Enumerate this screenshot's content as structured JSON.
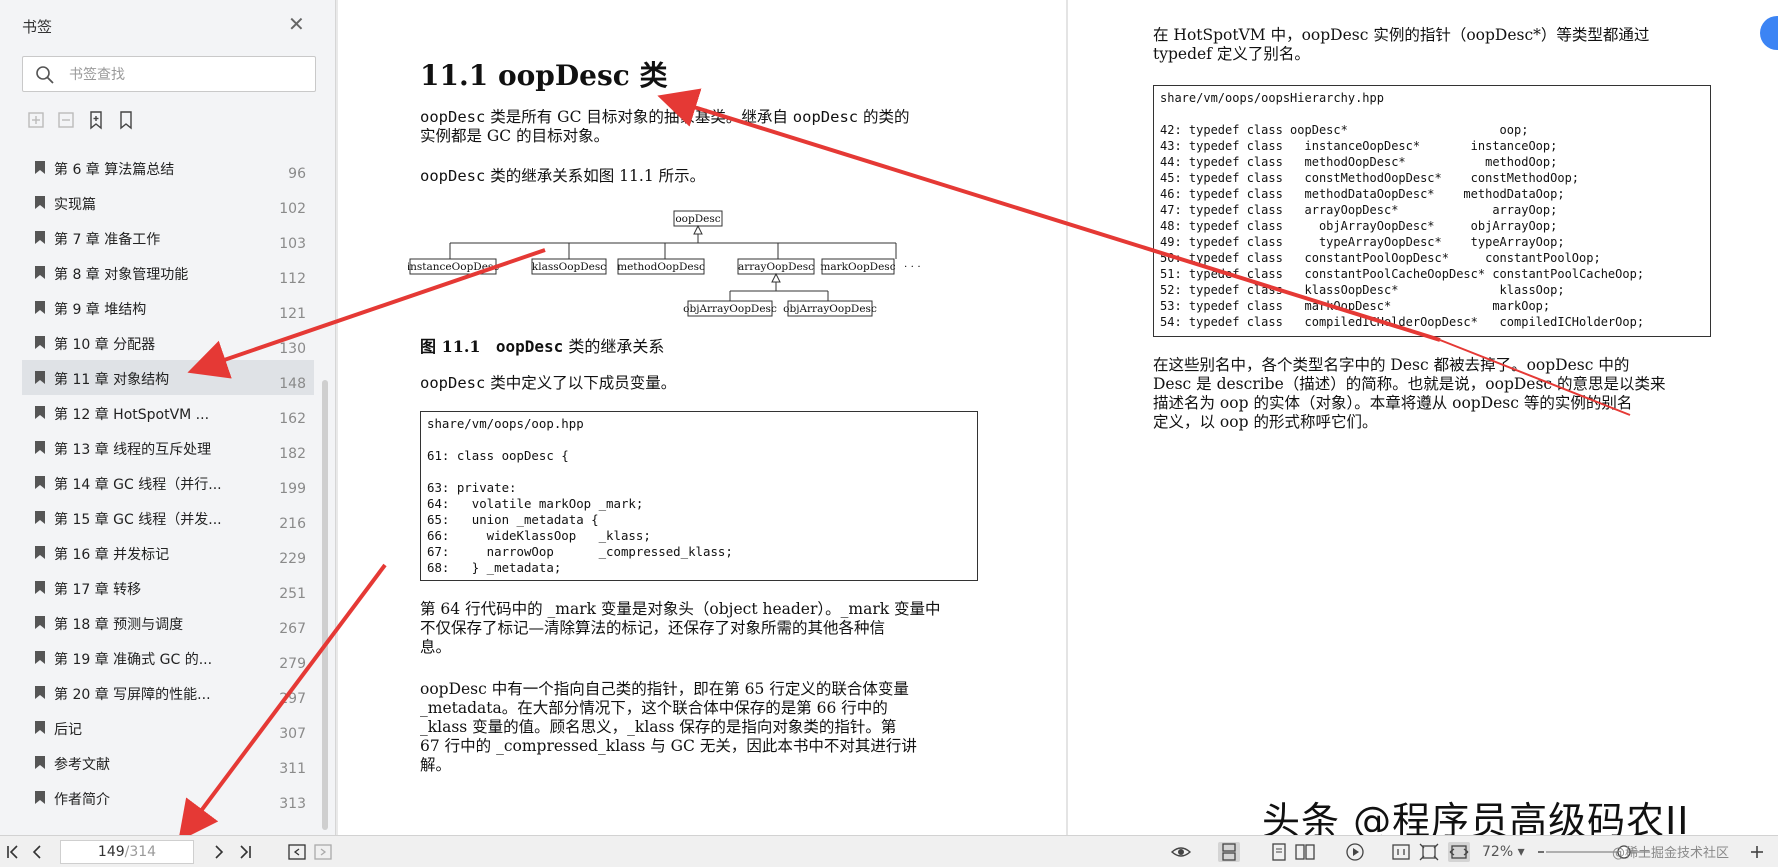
{
  "sidebar": {
    "title": "书签",
    "search_placeholder": "书签查找",
    "items": [
      {
        "label": "第 6 章   算法篇总结",
        "page": "96"
      },
      {
        "label": "实现篇",
        "page": "102"
      },
      {
        "label": "第 7 章   准备工作",
        "page": "103"
      },
      {
        "label": "第 8 章   对象管理功能",
        "page": "112"
      },
      {
        "label": "第 9 章   堆结构",
        "page": "121"
      },
      {
        "label": "第 10 章   分配器",
        "page": "130"
      },
      {
        "label": "第 11 章   对象结构",
        "page": "148"
      },
      {
        "label": "第 12 章   HotSpotVM ...",
        "page": "162"
      },
      {
        "label": "第 13 章   线程的互斥处理",
        "page": "182"
      },
      {
        "label": "第 14 章   GC 线程（并行...",
        "page": "199"
      },
      {
        "label": "第 15 章   GC 线程（并发...",
        "page": "216"
      },
      {
        "label": "第 16 章   并发标记",
        "page": "229"
      },
      {
        "label": "第 17 章   转移",
        "page": "251"
      },
      {
        "label": "第 18 章   预测与调度",
        "page": "267"
      },
      {
        "label": "第 19 章   准确式 GC 的...",
        "page": "279"
      },
      {
        "label": "第 20 章   写屏障的性能...",
        "page": "297"
      },
      {
        "label": "后记",
        "page": "307"
      },
      {
        "label": "参考文献",
        "page": "311"
      },
      {
        "label": "作者简介",
        "page": "313"
      }
    ],
    "active_index": 6
  },
  "left_page": {
    "title": "11.1    oopDesc 类",
    "p1_a": "oopDesc",
    "p1_b": " 类是所有 GC 目标对象的抽象基类。继承自 ",
    "p1_c": "oopDesc",
    "p1_d": " 的类的",
    "p1_e": "实例都是 GC 的目标对象。",
    "p2_a": "oopDesc",
    "p2_b": " 类的继承关系如图 11.1 所示。",
    "diagram": {
      "root": "oopDesc",
      "children": [
        "instanceOopDesc",
        "klassOopDesc",
        "methodOopDesc",
        "arrayOopDesc",
        "markOopDesc"
      ],
      "ellipsis": "· · ·",
      "grandchildren": [
        "objArrayOopDesc",
        "objArrayOopDesc"
      ]
    },
    "caption_num": "图 11.1",
    "caption_a": "oopDesc",
    "caption_b": " 类的继承关系",
    "p3_a": "oopDesc",
    "p3_b": " 类中定义了以下成员变量。",
    "code": "share/vm/oops/oop.hpp\n\n61: class oopDesc {\n\n63: private:\n64:   volatile markOop _mark;\n65:   union _metadata {\n66:     wideKlassOop   _klass;\n67:     narrowOop      _compressed_klass;\n68:   } _metadata;",
    "p4_l1": "第 64 行代码中的 _mark 变量是对象头（object header）。_mark 变量中",
    "p4_l2": "不仅保存了标记—清除算法的标记，还保存了对象所需的其他各种信",
    "p4_l3": "息。",
    "p5_l1": "oopDesc 中有一个指向自己类的指针，即在第 65 行定义的联合体变量",
    "p5_l2": "_metadata。在大部分情况下，这个联合体中保存的是第 66 行中的",
    "p5_l3": "_klass 变量的值。顾名思义，_klass 保存的是指向对象类的指针。第",
    "p5_l4": "67 行中的 _compressed_klass 与 GC 无关，因此本书中不对其进行讲",
    "p5_l5": "解。"
  },
  "right_page": {
    "intro_l1": "在 HotSpotVM 中，oopDesc 实例的指针（oopDesc*）等类型都通过",
    "intro_l2": "typedef 定义了别名。",
    "code": "share/vm/oops/oopsHierarchy.hpp\n\n42: typedef class oopDesc*                     oop;\n43: typedef class   instanceOopDesc*       instanceOop;\n44: typedef class   methodOopDesc*           methodOop;\n45: typedef class   constMethodOopDesc*    constMethodOop;\n46: typedef class   methodDataOopDesc*    methodDataOop;\n47: typedef class   arrayOopDesc*             arrayOop;\n48: typedef class     objArrayOopDesc*     objArrayOop;\n49: typedef class     typeArrayOopDesc*    typeArrayOop;\n50: typedef class   constantPoolOopDesc*     constantPoolOop;\n51: typedef class   constantPoolCacheOopDesc* constantPoolCacheOop;\n52: typedef class   klassOopDesc*              klassOop;\n53: typedef class   markOopDesc*              markOop;\n54: typedef class   compiledICHolderOopDesc*   compiledICHolderOop;",
    "p_l1": "在这些别名中，各个类型名字中的 Desc 都被去掉了。oopDesc 中的",
    "p_l2": "Desc 是 describe（描述）的简称。也就是说，oopDesc 的意思是以类来",
    "p_l3": "描述名为 oop 的实体（对象）。本章将遵从 oopDesc 等的实例的别名",
    "p_l4": "定义，以 oop 的形式称呼它们。"
  },
  "bottom": {
    "current_page": "149",
    "total_pages": "/314",
    "zoom": "72%",
    "zoom_caret": "▾"
  },
  "watermark": "头条 @程序员高级码农II",
  "watermark_small": "@稀土掘金技术社区",
  "colors": {
    "arrow": "#e53935",
    "active_item": "#dfe2e6",
    "badge": "#3c84f4"
  }
}
